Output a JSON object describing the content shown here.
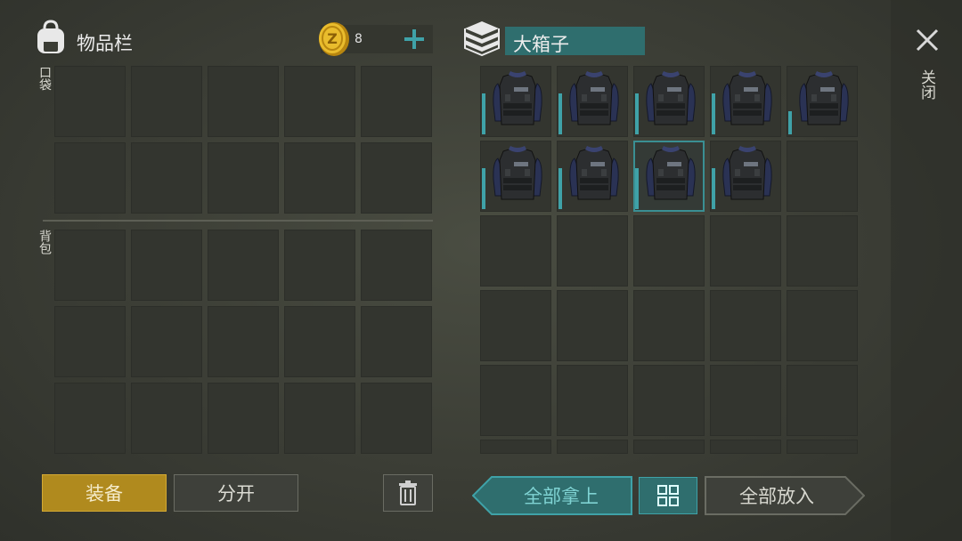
{
  "inventory": {
    "title": "物品栏",
    "coin_count": "8",
    "pocket_label": "口袋",
    "backpack_label": "背包"
  },
  "container": {
    "title": "大箱子",
    "item_name": "police-vest",
    "items_in_row1": 5,
    "items_in_row2": 4
  },
  "close": {
    "label": "关闭"
  },
  "buttons": {
    "equip": "装备",
    "split": "分开",
    "take_all": "全部拿上",
    "put_all": "全部放入"
  },
  "colors": {
    "accent": "#3fa2a8",
    "equip_bg": "#b08a1e",
    "coin": "#e1b227"
  }
}
